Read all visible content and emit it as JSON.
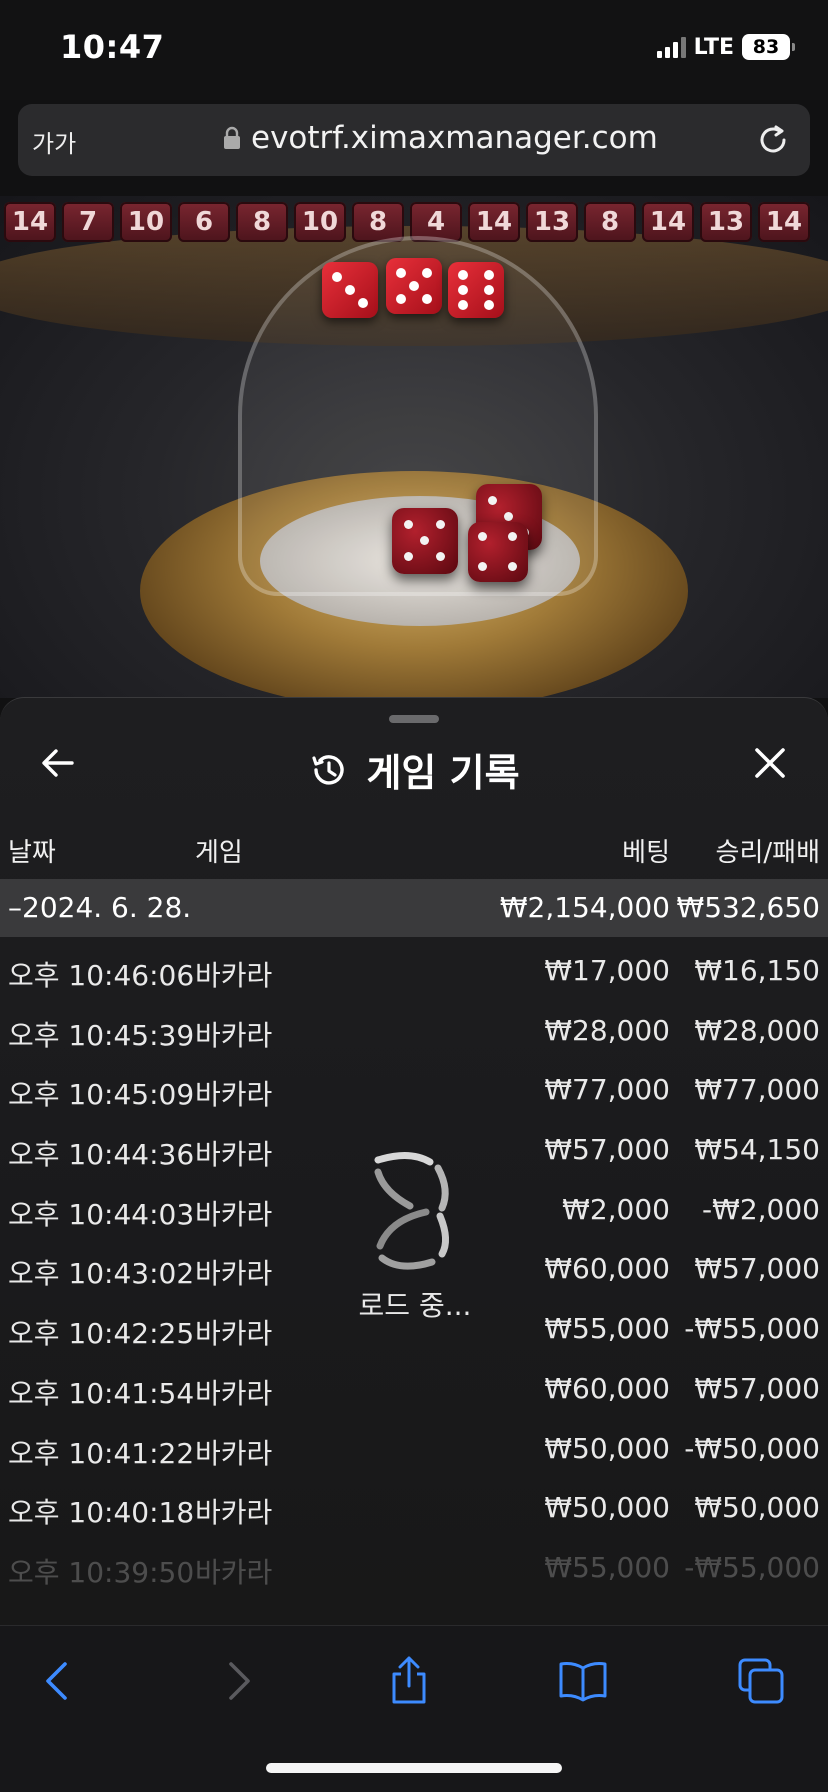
{
  "status_bar": {
    "time": "10:47",
    "network": "LTE",
    "battery": "83"
  },
  "url_bar": {
    "text_size_label": "가가",
    "url": "evotrf.ximaxmanager.com"
  },
  "game_history_chips": [
    "14",
    "7",
    "10",
    "6",
    "8",
    "10",
    "8",
    "4",
    "14",
    "13",
    "8",
    "14",
    "13",
    "14"
  ],
  "panel": {
    "title": "게임 기록",
    "columns": {
      "date": "날짜",
      "game": "게임",
      "bet": "베팅",
      "win_loss": "승리/패배"
    },
    "date_group": {
      "label": "–2024. 6. 28.",
      "total_bet": "₩2,154,000",
      "total_win_loss": "₩532,650"
    },
    "rows": [
      {
        "time": "오후 10:46:06",
        "game": "바카라",
        "bet": "₩17,000",
        "win_loss": "₩16,150"
      },
      {
        "time": "오후 10:45:39",
        "game": "바카라",
        "bet": "₩28,000",
        "win_loss": "₩28,000"
      },
      {
        "time": "오후 10:45:09",
        "game": "바카라",
        "bet": "₩77,000",
        "win_loss": "₩77,000"
      },
      {
        "time": "오후 10:44:36",
        "game": "바카라",
        "bet": "₩57,000",
        "win_loss": "₩54,150"
      },
      {
        "time": "오후 10:44:03",
        "game": "바카라",
        "bet": "₩2,000",
        "win_loss": "-₩2,000"
      },
      {
        "time": "오후 10:43:02",
        "game": "바카라",
        "bet": "₩60,000",
        "win_loss": "₩57,000"
      },
      {
        "time": "오후 10:42:25",
        "game": "바카라",
        "bet": "₩55,000",
        "win_loss": "-₩55,000"
      },
      {
        "time": "오후 10:41:54",
        "game": "바카라",
        "bet": "₩60,000",
        "win_loss": "₩57,000"
      },
      {
        "time": "오후 10:41:22",
        "game": "바카라",
        "bet": "₩50,000",
        "win_loss": "-₩50,000"
      },
      {
        "time": "오후 10:40:18",
        "game": "바카라",
        "bet": "₩50,000",
        "win_loss": "₩50,000"
      },
      {
        "time": "오후 10:39:50",
        "game": "바카라",
        "bet": "₩55,000",
        "win_loss": "-₩55,000"
      }
    ],
    "loading_text": "로드 중..."
  },
  "toolbar": {
    "icons": [
      "back-icon",
      "forward-icon",
      "share-icon",
      "bookmarks-icon",
      "tabs-icon"
    ]
  },
  "colors": {
    "accent_blue": "#3d8bff",
    "panel_bg": "#1c1c1e",
    "date_row_bg": "#3a3a3c"
  }
}
